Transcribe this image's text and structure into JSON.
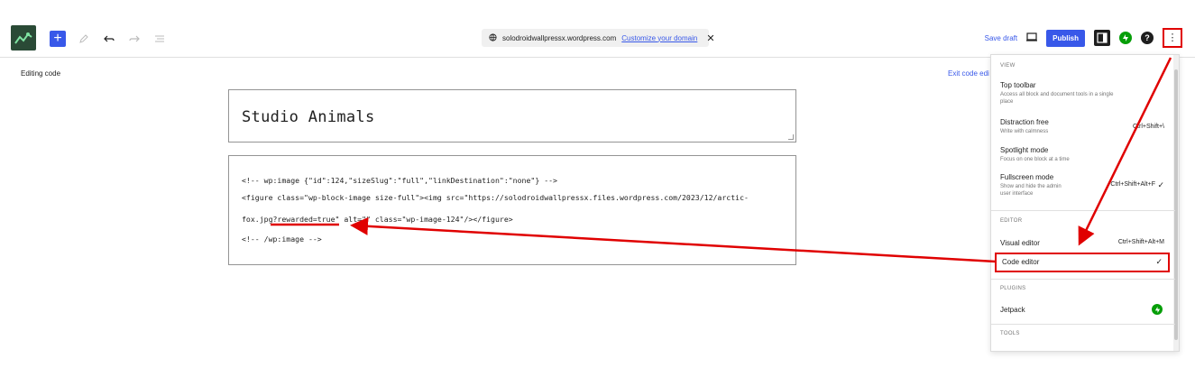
{
  "header": {
    "command_bar": {
      "site_url": "solodroidwallpressx.wordpress.com",
      "domain_link": "Customize your domain",
      "close_glyph": "✕"
    },
    "save_draft": "Save draft",
    "publish": "Publish",
    "help_glyph": "?",
    "options_glyph": "⋮",
    "add_glyph": "+"
  },
  "editor": {
    "mode_label": "Editing code",
    "exit_link": "Exit code editor",
    "title": "Studio Animals",
    "code_lines": [
      "<!-- wp:image {\"id\":124,\"sizeSlug\":\"full\",\"linkDestination\":\"none\"} -->",
      "<figure class=\"wp-block-image size-full\"><img src=\"https://solodroidwallpressx.files.wordpress.com/2023/12/arctic-",
      "fox.jpg?rewarded=true\" alt=\"\" class=\"wp-image-124\"/></figure>",
      "<!-- /wp:image -->"
    ]
  },
  "menu": {
    "view_heading": "VIEW",
    "view_items": [
      {
        "label": "Top toolbar",
        "desc1": "Access all block and document tools in a single",
        "desc2": "place",
        "shortcut": "",
        "check": ""
      },
      {
        "label": "Distraction free",
        "desc1": "Write with calmness",
        "desc2": "",
        "shortcut": "Ctrl+Shift+\\",
        "check": ""
      },
      {
        "label": "Spotlight mode",
        "desc1": "Focus on one block at a time",
        "desc2": "",
        "shortcut": "",
        "check": ""
      },
      {
        "label": "Fullscreen mode",
        "desc1": "Show and hide the admin",
        "desc2": "user interface",
        "shortcut": "Ctrl+Shift+Alt+F",
        "check": "✓"
      }
    ],
    "editor_heading": "EDITOR",
    "visual_editor": {
      "label": "Visual editor",
      "shortcut": "Ctrl+Shift+Alt+M"
    },
    "code_editor": {
      "label": "Code editor",
      "check": "✓"
    },
    "plugins_heading": "PLUGINS",
    "jetpack": "Jetpack",
    "tools_heading": "TOOLS"
  },
  "colors": {
    "accent": "#3858e9",
    "annotation": "#e00000",
    "jetpack": "#069e08",
    "logo_bg": "#2a4a36"
  }
}
